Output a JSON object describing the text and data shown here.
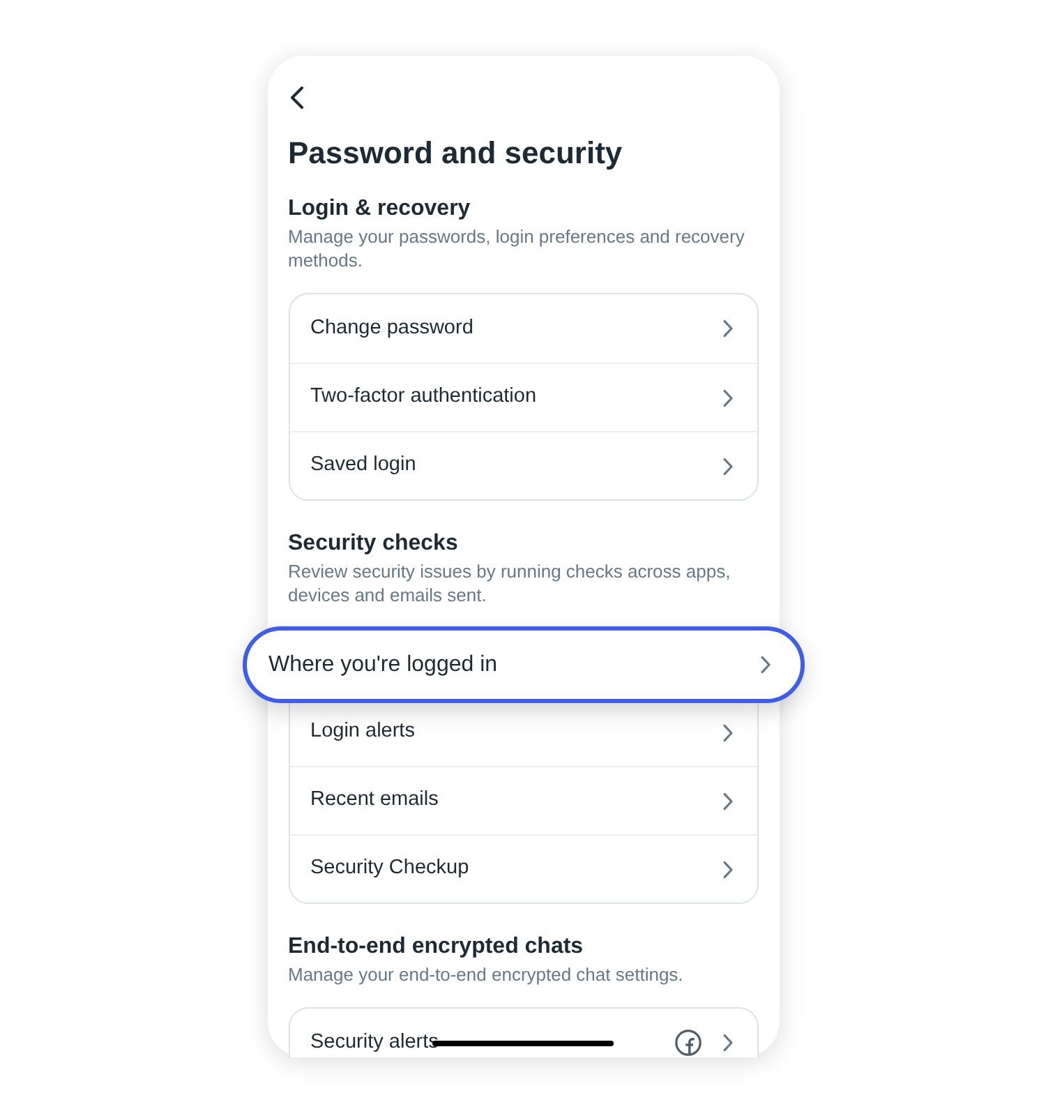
{
  "screen": {
    "title": "Password and security"
  },
  "sections": [
    {
      "title": "Login & recovery",
      "description": "Manage your passwords, login preferences and recovery methods.",
      "items": [
        {
          "label": "Change password",
          "kind": "link",
          "highlighted": false
        },
        {
          "label": "Two-factor authentication",
          "kind": "link",
          "highlighted": false
        },
        {
          "label": "Saved login",
          "kind": "link",
          "highlighted": false
        }
      ]
    },
    {
      "title": "Security checks",
      "description": "Review security issues by running checks across apps, devices and emails sent.",
      "items": [
        {
          "label": "Where you're logged in",
          "kind": "link",
          "highlighted": true
        },
        {
          "label": "Login alerts",
          "kind": "link",
          "highlighted": false
        },
        {
          "label": "Recent emails",
          "kind": "link",
          "highlighted": false
        },
        {
          "label": "Security Checkup",
          "kind": "link",
          "highlighted": false
        }
      ]
    },
    {
      "title": "End-to-end encrypted chats",
      "description": "Manage your end-to-end encrypted chat settings.",
      "items": [
        {
          "label": "Security alerts",
          "kind": "app_link",
          "highlighted": false
        }
      ]
    }
  ]
}
